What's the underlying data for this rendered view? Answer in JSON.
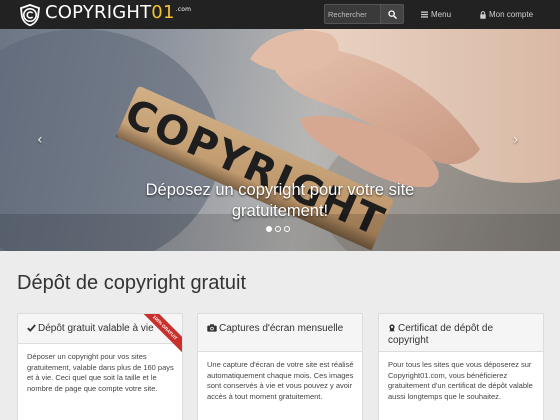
{
  "brand": {
    "name_prefix": "COPYRIGHT",
    "name_suffix": "01",
    "tld": ".com",
    "suffix_color": "#f2c12e"
  },
  "navbar": {
    "search": {
      "placeholder": "Rechercher",
      "icon": "search-icon"
    },
    "menu_label": "Menu",
    "menu_icon": "bars-icon",
    "account_label": "Mon compte",
    "account_icon": "lock-icon"
  },
  "hero": {
    "caption": "Déposez un copyright pour votre site gratuitement!",
    "stamp_text": "COPYRIGHT",
    "slide_count": 3,
    "active_slide": 1
  },
  "main": {
    "title": "Dépôt de copyright gratuit",
    "panels": [
      {
        "icon": "check-icon",
        "title": "Dépôt gratuit valable à vie",
        "body": "Déposer un copyright pour vos sites gratuitement, valable dans plus de 160 pays et à vie. Ceci quel que soit la taille et le nombre de page que compte votre site.",
        "ribbon": "100% GRATUIT"
      },
      {
        "icon": "camera-icon",
        "title": "Captures d'écran mensuelle",
        "body": "Une capture d'écran de votre site est réalisé automatiquement chaque mois. Ces images sont conservés à vie et vous pouvez y avoir accès à tout moment gratuitement."
      },
      {
        "icon": "certificate-icon",
        "title": "Certificat de dépôt de copyright",
        "body": "Pour tous les sites que vous déposerez sur Copyright01.com, vous bénéficierez gratuitement d'un certificat de dépôt valable aussi longtemps que le souhaitez."
      }
    ]
  },
  "colors": {
    "navbar": "#222222",
    "accent_button": "#2f7dbb",
    "ribbon": "#c9302c"
  }
}
